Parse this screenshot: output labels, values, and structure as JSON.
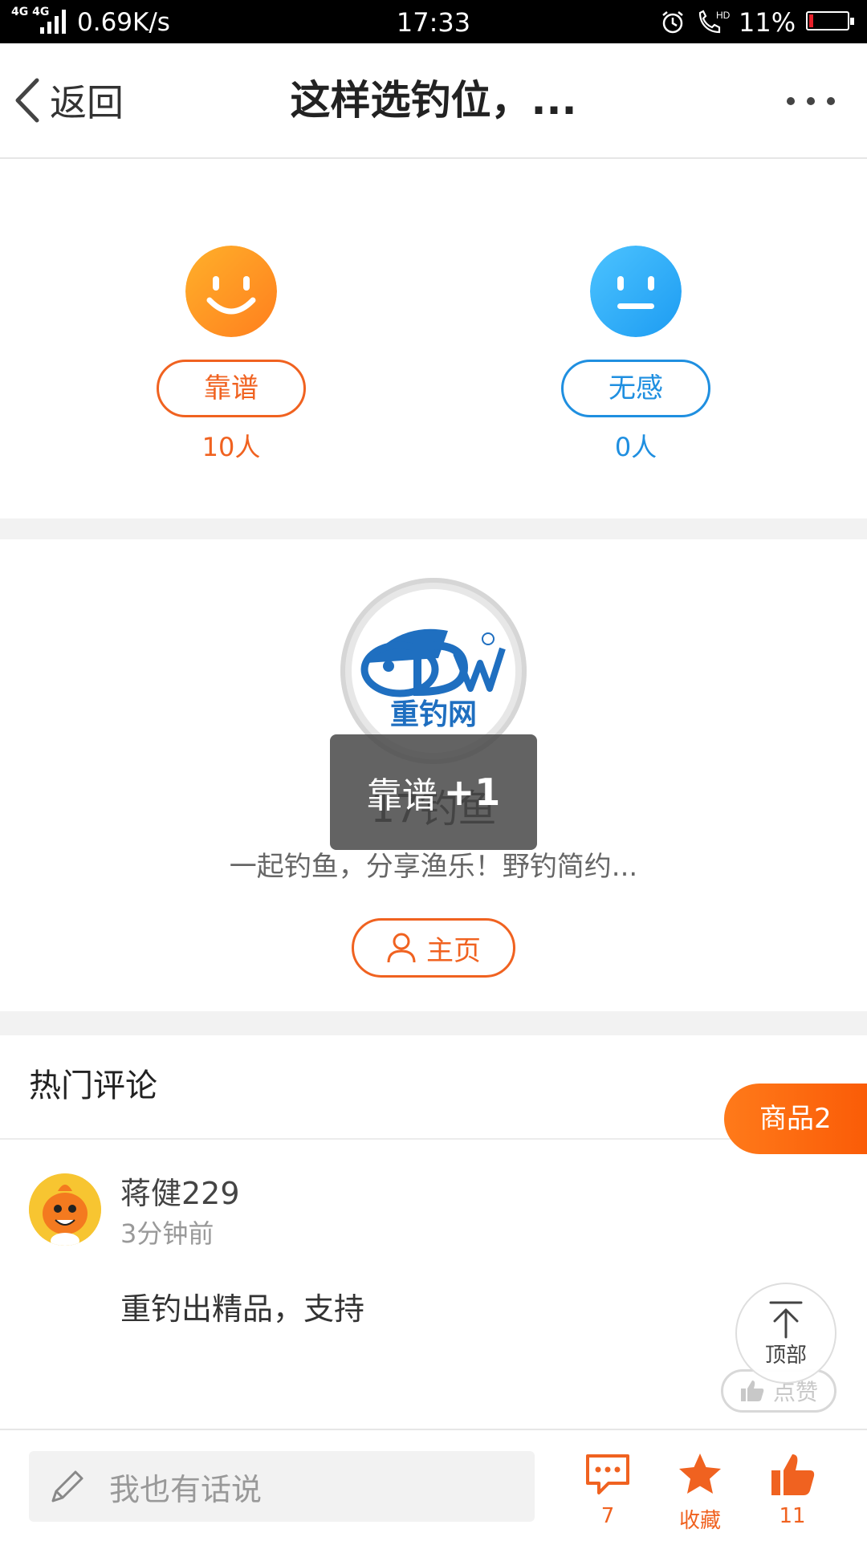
{
  "status_bar": {
    "network": "4G 4G",
    "speed": "0.69K/s",
    "time": "17:33",
    "battery_pct": "11%",
    "battery_level": 0.11,
    "hd_label": "HD"
  },
  "nav": {
    "back_label": "返回",
    "title": "这样选钓位，..."
  },
  "reactions": {
    "positive": {
      "label": "靠谱",
      "count": "10人",
      "color": "#f06220"
    },
    "neutral": {
      "label": "无感",
      "count": "0人",
      "color": "#1f8fe0"
    }
  },
  "author": {
    "logo_text": "重钓网",
    "name": "17钓鱼",
    "description": "一起钓鱼，分享渔乐！野钓简约...",
    "home_label": "主页"
  },
  "toast": {
    "text": "靠谱",
    "plus": "+1"
  },
  "comments": {
    "title": "热门评论",
    "goods_label": "商品2",
    "items": [
      {
        "user": "蒋健229",
        "time": "3分钟前",
        "text": "重钓出精品，支持",
        "like_label": "点赞"
      }
    ]
  },
  "floating": {
    "top_label": "顶部"
  },
  "bottom_bar": {
    "input_placeholder": "我也有话说",
    "comment_count": "7",
    "favorite_label": "收藏",
    "like_count": "11"
  },
  "colors": {
    "accent": "#f06220",
    "blue": "#1f8fe0",
    "divider": "#f2f2f2"
  }
}
